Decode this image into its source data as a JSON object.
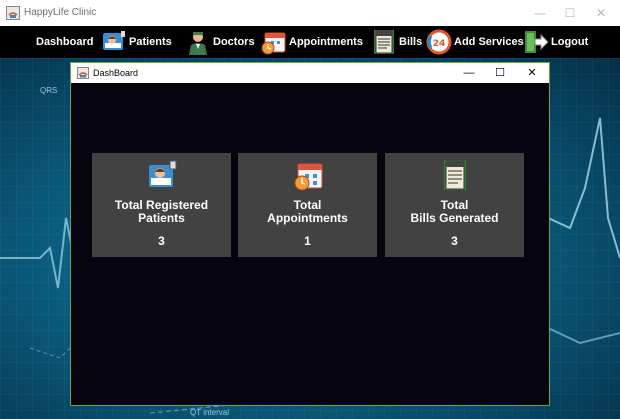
{
  "window": {
    "title": "HappyLife Clinic",
    "controls": {
      "minimize": "—",
      "maximize": "☐",
      "close": "✕"
    }
  },
  "menu": [
    {
      "label": "Dashboard",
      "icon": null
    },
    {
      "label": "Patients",
      "icon": "patient-bed-icon"
    },
    {
      "label": "Doctors",
      "icon": "doctor-icon"
    },
    {
      "label": "Appointments",
      "icon": "calendar-clock-icon"
    },
    {
      "label": "Bills",
      "icon": "bill-icon"
    },
    {
      "label": "Add Services",
      "icon": "24h-service-icon"
    },
    {
      "label": "Logout",
      "icon": "logout-door-icon"
    }
  ],
  "background": {
    "labels": [
      "QRS",
      "QT interval"
    ]
  },
  "dashboard": {
    "title": "DashBoard",
    "controls": {
      "minimize": "—",
      "maximize": "☐",
      "close": "✕"
    },
    "cards": [
      {
        "label": "Total Registered\nPatients",
        "value": "3",
        "icon": "patient-bed-icon"
      },
      {
        "label": "Total\nAppointments",
        "value": "1",
        "icon": "calendar-clock-icon"
      },
      {
        "label": "Total\nBills Generated",
        "value": "3",
        "icon": "bill-icon"
      }
    ]
  },
  "colors": {
    "menubar": "#000000",
    "dashboard_bg": "#05040f",
    "card_bg": "#424242",
    "frame_border": "#6fa63a"
  }
}
